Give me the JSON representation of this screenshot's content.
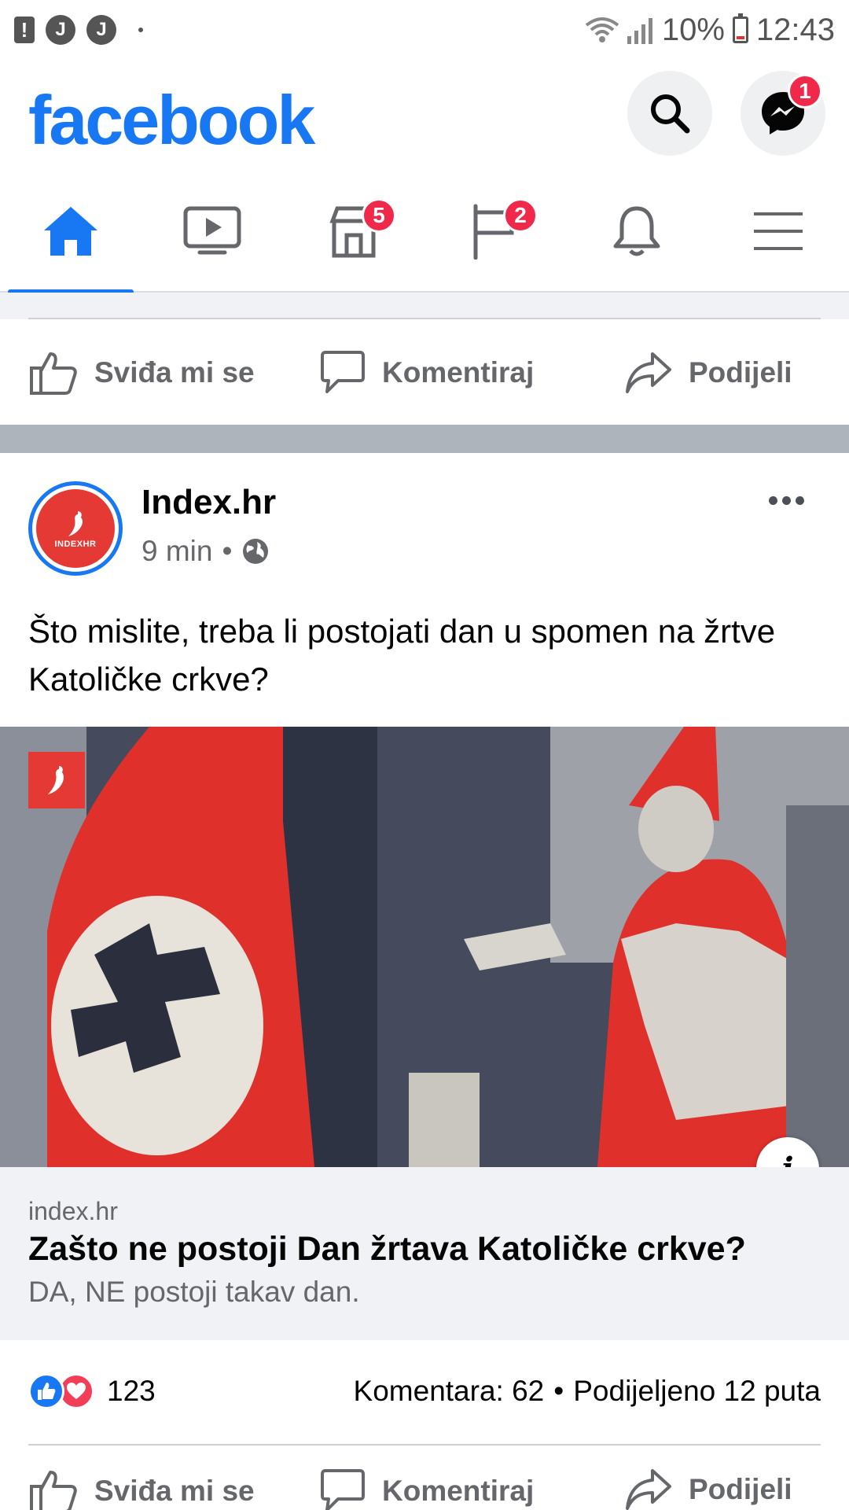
{
  "status_bar": {
    "left_icons": [
      "alert-icon",
      "j-notification-icon",
      "j-notification-icon",
      "dot-icon"
    ],
    "j_label": "J",
    "alert_label": "!",
    "battery": "10%",
    "time": "12:43"
  },
  "header": {
    "logo": "facebook",
    "messenger_badge": "1"
  },
  "nav": {
    "tabs": [
      {
        "name": "home",
        "badge": ""
      },
      {
        "name": "watch",
        "badge": ""
      },
      {
        "name": "marketplace",
        "badge": "5"
      },
      {
        "name": "pages",
        "badge": "2"
      },
      {
        "name": "notifications",
        "badge": ""
      },
      {
        "name": "menu",
        "badge": ""
      }
    ]
  },
  "prev_post_actions": {
    "like": "Sviđa mi se",
    "comment": "Komentiraj",
    "share": "Podijeli"
  },
  "post": {
    "author": "Index.hr",
    "avatar_text": "INDEXHR",
    "time": "9 min",
    "meta_sep": "•",
    "text": "Što mislite, treba li postojati dan u spomen na žrtve Katoličke crkve?",
    "info_label": "i",
    "link": {
      "domain": "index.hr",
      "title": "Zašto ne postoji Dan žrtava Katoličke crkve?",
      "description": "DA, NE postoji takav dan."
    },
    "reactions_count": "123",
    "comments": "Komentara: 62",
    "stats_sep": "•",
    "shares": "Podijeljeno 12 puta",
    "actions": {
      "like": "Sviđa mi se",
      "comment": "Komentiraj",
      "share": "Podijeli"
    }
  },
  "colors": {
    "brand": "#1877f2",
    "badge": "#f02849",
    "text_secondary": "#65676b"
  }
}
